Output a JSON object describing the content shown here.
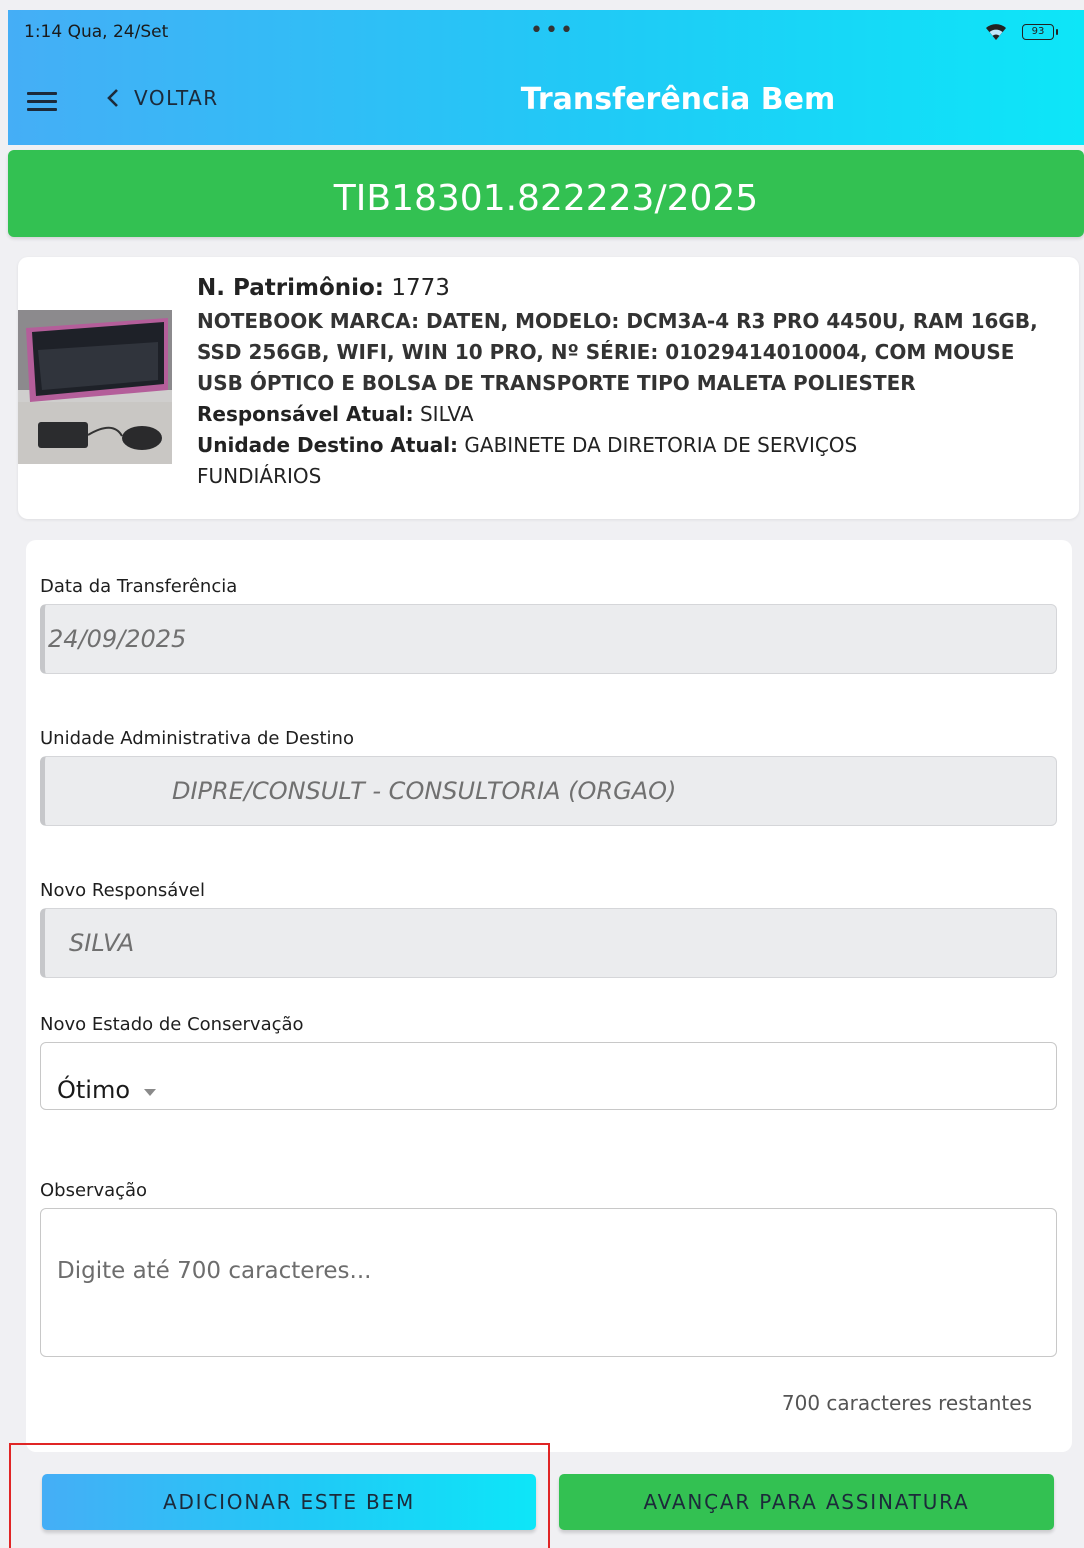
{
  "status_bar": {
    "time": "1:14  Qua, 24/Set",
    "dots": "•••",
    "battery": "93"
  },
  "header": {
    "back_label": "VOLTAR",
    "title": "Transferência Bem"
  },
  "transfer_code": "TIB18301.822223/2025",
  "asset": {
    "patrimonio_label": "N. Patrimônio:",
    "patrimonio_value": "1773",
    "description": "NOTEBOOK MARCA: DATEN, MODELO: DCM3A-4 R3 PRO 4450U, RAM 16GB, SSD 256GB, WIFI, WIN 10 PRO, Nº SÉRIE: 01029414010004, COM MOUSE USB ÓPTICO E BOLSA DE TRANSPORTE TIPO MALETA POLIESTER",
    "responsavel_label": "Responsável Atual:",
    "responsavel_value": "SILVA",
    "unidade_label": "Unidade Destino Atual:",
    "unidade_value": "GABINETE DA DIRETORIA DE SERVIÇOS FUNDIÁRIOS"
  },
  "form": {
    "date_label": "Data da Transferência",
    "date_value": "24/09/2025",
    "unit_label": "Unidade Administrativa de Destino",
    "unit_value": "DIPRE/CONSULT - CONSULTORIA  (ORGAO)",
    "responsible_label": "Novo Responsável",
    "responsible_value": "SILVA",
    "condition_label": "Novo Estado de Conservação",
    "condition_value": "Ótimo",
    "observation_label": "Observação",
    "observation_placeholder": "Digite até 700 caracteres...",
    "counter": "700 caracteres restantes"
  },
  "buttons": {
    "add": "ADICIONAR ESTE BEM",
    "next": "AVANÇAR PARA ASSINATURA"
  },
  "colors": {
    "header_gradient_start": "#45aef6",
    "header_gradient_end": "#0de6f8",
    "green": "#33c152",
    "highlight": "#e02525"
  }
}
